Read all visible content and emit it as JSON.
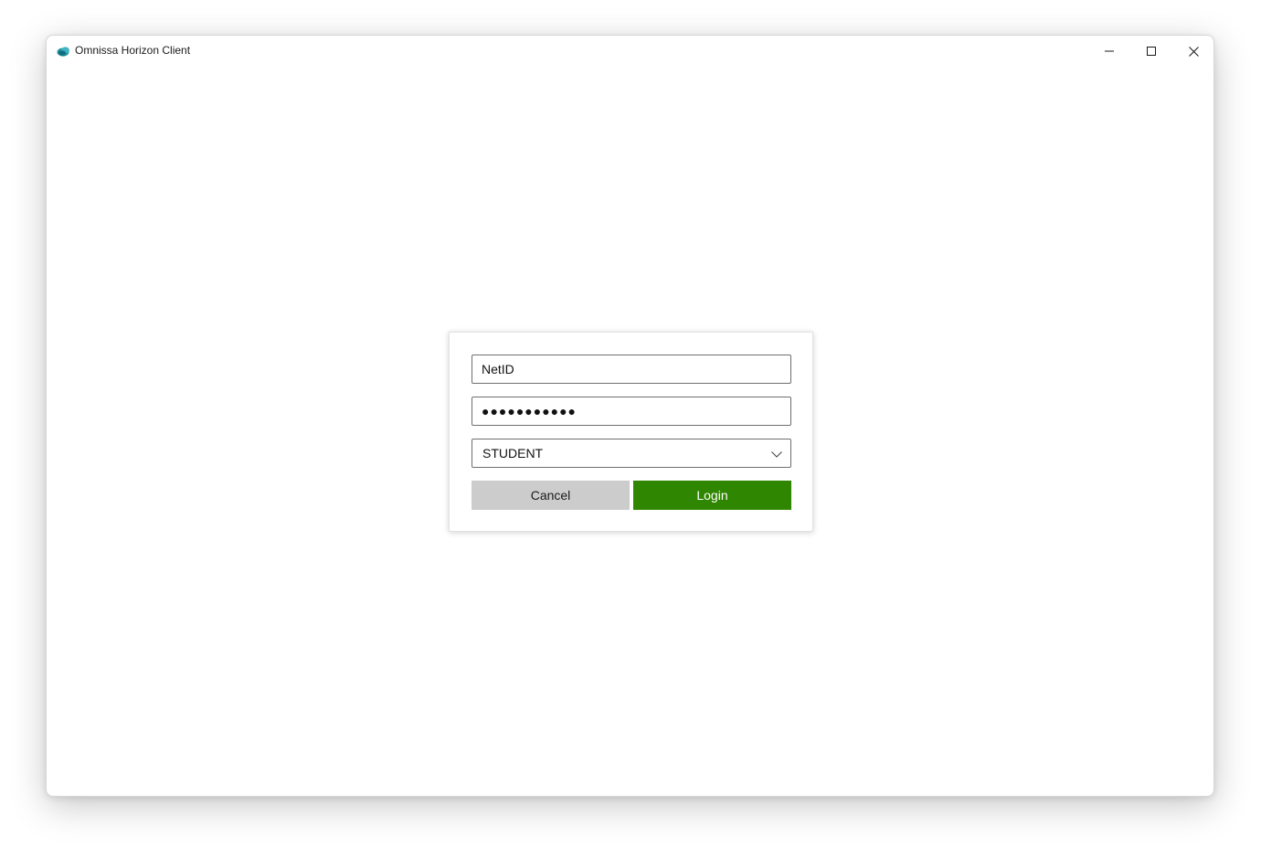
{
  "window": {
    "title": "Omnissa Horizon Client",
    "controls": {
      "minimize_icon": "minimize-icon",
      "maximize_icon": "maximize-icon",
      "close_icon": "close-icon"
    }
  },
  "login": {
    "username_value": "NetID",
    "password_value": "●●●●●●●●●●●",
    "domain": {
      "selected": "STUDENT",
      "icon": "chevron-down-icon"
    },
    "cancel_label": "Cancel",
    "login_label": "Login"
  },
  "colors": {
    "login_button": "#2f8600",
    "cancel_button": "#cccccc",
    "app_icon": "#1b8fa0"
  }
}
